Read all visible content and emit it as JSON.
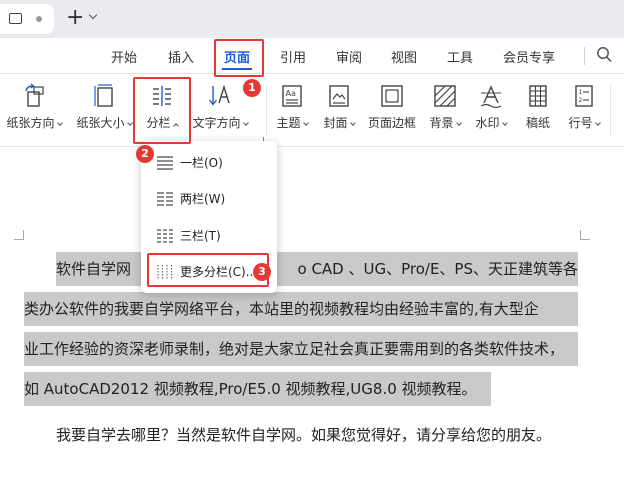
{
  "menu": {
    "items": [
      "开始",
      "插入",
      "页面",
      "引用",
      "审阅",
      "视图",
      "工具",
      "会员专享"
    ],
    "active_index": 2,
    "active_color": "#1f5fd6"
  },
  "ribbon": {
    "tools": [
      {
        "label": "纸张方向",
        "icon": "page-orientation-icon"
      },
      {
        "label": "纸张大小",
        "icon": "page-size-icon"
      },
      {
        "label": "分栏",
        "icon": "columns-icon"
      },
      {
        "label": "文字方向",
        "icon": "text-direction-icon"
      },
      {
        "label": "主题",
        "icon": "theme-icon"
      },
      {
        "label": "封面",
        "icon": "cover-icon"
      },
      {
        "label": "页面边框",
        "icon": "page-border-icon"
      },
      {
        "label": "背景",
        "icon": "background-icon"
      },
      {
        "label": "水印",
        "icon": "watermark-icon"
      },
      {
        "label": "稿纸",
        "icon": "manuscript-paper-icon"
      },
      {
        "label": "行号",
        "icon": "line-number-icon"
      }
    ]
  },
  "dropdown": {
    "items": [
      "一栏(O)",
      "两栏(W)",
      "三栏(T)",
      "更多分栏(C)..."
    ]
  },
  "annotations": {
    "badges": [
      "1",
      "2",
      "3"
    ],
    "color": "#e53935"
  },
  "document": {
    "lines": [
      "软件自学网",
      "o CAD 、UG、Pro/E、PS、天正建筑等各",
      "类办公软件的我要自学网络平台，本站里的视频教程均由经验丰富的,有大型企",
      "业工作经验的资深老师录制，绝对是大家立足社会真正要需用到的各类软件技术，",
      "如 AutoCAD2012 视频教程,Pro/E5.0 视频教程,UG8.0 视频教程。",
      "我要自学去哪里？当然是软件自学网。如果您觉得好，请分享给您的朋友。"
    ],
    "selection_color": "#c9c9c9"
  }
}
